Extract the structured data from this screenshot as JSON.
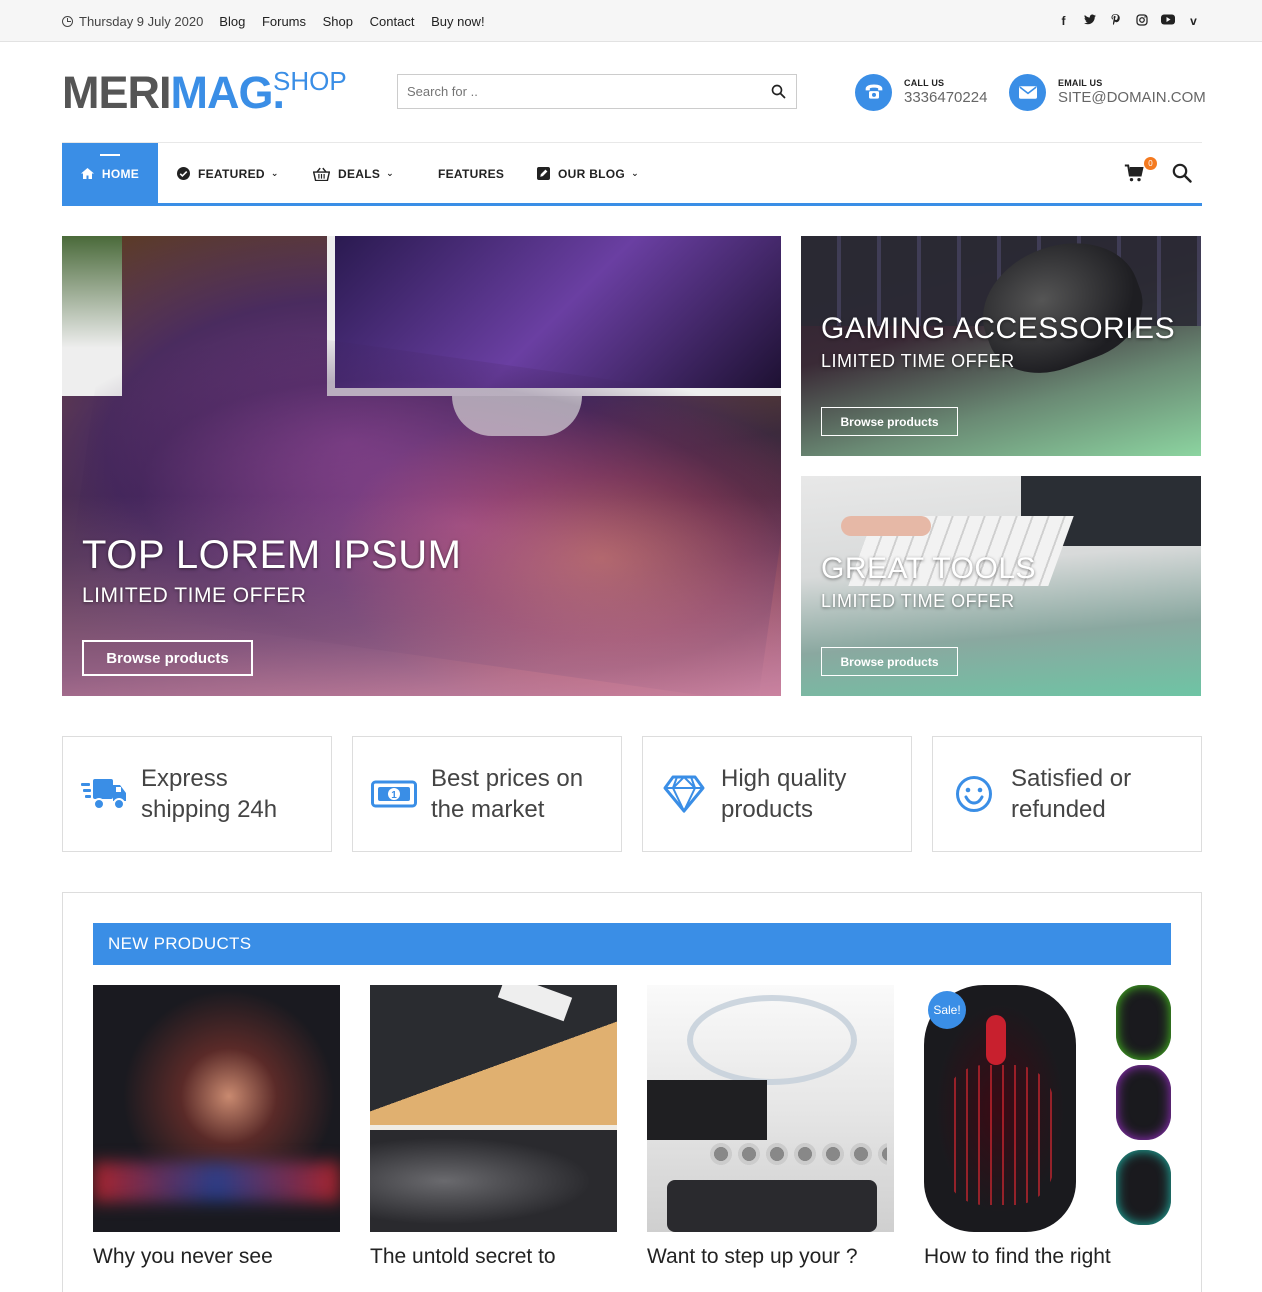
{
  "topbar": {
    "date": "Thursday 9 July 2020",
    "links": [
      "Blog",
      "Forums",
      "Shop",
      "Contact",
      "Buy now!"
    ],
    "social": [
      "facebook-icon",
      "twitter-icon",
      "pinterest-icon",
      "instagram-icon",
      "youtube-icon",
      "vimeo-icon"
    ],
    "social_glyphs": [
      "f",
      "t",
      "p",
      "◎",
      "▶",
      "v"
    ]
  },
  "header": {
    "logo_part1": "MERI",
    "logo_part2": "MAG",
    "logo_dot": ".",
    "logo_shop": "SHOP",
    "search_placeholder": "Search for ..",
    "call_label": "CALL US",
    "call_value": "3336470224",
    "email_label": "EMAIL US",
    "email_value": "SITE@DOMAIN.COM"
  },
  "nav": {
    "home": "HOME",
    "featured": "FEATURED",
    "deals": "DEALS",
    "features": "FEATURES",
    "blog": "OUR BLOG",
    "cart_count": "0"
  },
  "hero": {
    "main": {
      "title": "TOP LOREM IPSUM",
      "subtitle": "LIMITED TIME OFFER",
      "button": "Browse products"
    },
    "side1": {
      "title": "GAMING ACCESSORIES",
      "subtitle": "LIMITED TIME OFFER",
      "button": "Browse products"
    },
    "side2": {
      "title": "GREAT TOOLS",
      "subtitle": "LIMITED TIME OFFER",
      "button": "Browse products"
    }
  },
  "features": [
    {
      "line1": "Express",
      "line2": "shipping 24h",
      "icon": "truck-icon"
    },
    {
      "line1": "Best prices on",
      "line2": "the market",
      "icon": "money-icon"
    },
    {
      "line1": "High quality",
      "line2": "products",
      "icon": "diamond-icon"
    },
    {
      "line1": "Satisfied or",
      "line2": "refunded",
      "icon": "smile-icon"
    }
  ],
  "new_products": {
    "heading": "NEW PRODUCTS",
    "items": [
      {
        "title": "Why you never see"
      },
      {
        "title": "The untold secret to"
      },
      {
        "title": "Want to step up your ?"
      },
      {
        "title": "How to find the right",
        "badge": "Sale!"
      }
    ]
  },
  "colors": {
    "accent": "#3a8ee6",
    "cart_badge": "#f47a20"
  }
}
